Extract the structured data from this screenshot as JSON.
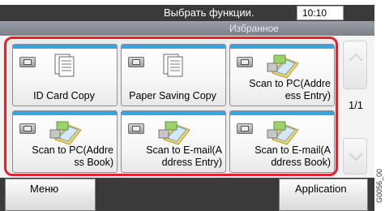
{
  "header": {
    "title": "Выбрать функции.",
    "time": "10:10"
  },
  "subheader": {
    "title": "Избранное"
  },
  "favorites": [
    {
      "label": "ID Card Copy",
      "align": "center",
      "icon": "copy-documents-icon"
    },
    {
      "label": "Paper Saving Copy",
      "align": "center",
      "icon": "copy-documents-icon"
    },
    {
      "label": "Scan to PC(Addre\ness Entry)",
      "align": "right",
      "icon": "scan-to-folder-icon"
    },
    {
      "label": "Scan to PC(Addre\nss Book)",
      "align": "right",
      "icon": "scan-to-folder-icon"
    },
    {
      "label": "Scan to E-mail(A\nddress Entry)",
      "align": "right",
      "icon": "scan-to-email-icon"
    },
    {
      "label": "Scan to E-mail(A\nddress Book)",
      "align": "right",
      "icon": "scan-to-email-icon"
    }
  ],
  "pager": {
    "label": "1/1"
  },
  "footer": {
    "menu_label": "Меню",
    "application_label": "Application"
  },
  "figure_code": "G0056_00",
  "colors": {
    "accent_border": "#e8202a",
    "tile_stripe": "#37a4e0",
    "header_bg": "#3a3a3a"
  }
}
